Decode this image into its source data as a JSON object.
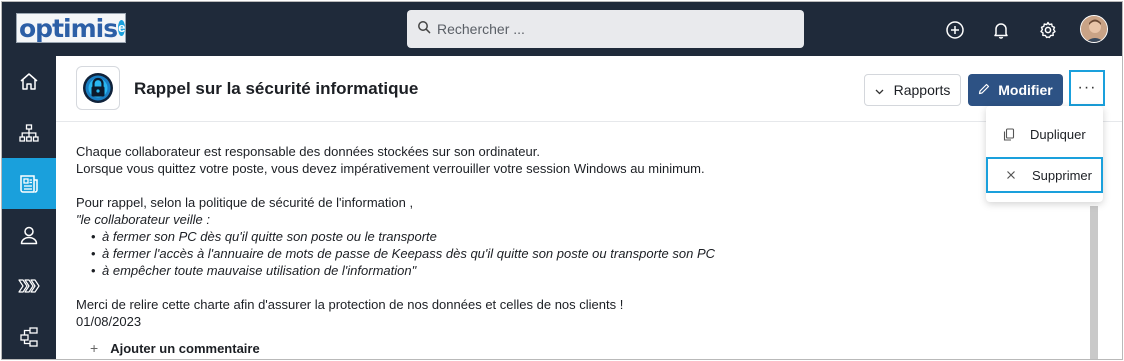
{
  "brand": {
    "logo_text": "optimis",
    "logo_badge": "e"
  },
  "search": {
    "placeholder": "Rechercher ..."
  },
  "topbar": {
    "icons": [
      "plus-circle-icon",
      "bell-icon",
      "gear-icon"
    ],
    "avatar": "user-avatar"
  },
  "sidebar": {
    "items": [
      {
        "name": "home-icon",
        "active": false
      },
      {
        "name": "org-chart-icon",
        "active": false
      },
      {
        "name": "news-icon",
        "active": true
      },
      {
        "name": "person-icon",
        "active": false
      },
      {
        "name": "chevrons-icon",
        "active": false
      },
      {
        "name": "process-icon",
        "active": false
      }
    ]
  },
  "header": {
    "title": "Rappel sur la sécurité informatique",
    "rapports_label": "Rapports",
    "modifier_label": "Modifier",
    "more_label": "···"
  },
  "menu": {
    "items": [
      {
        "label": "Dupliquer",
        "icon": "copy-icon"
      },
      {
        "label": "Supprimer",
        "icon": "close-icon"
      }
    ]
  },
  "content": {
    "line1": "Chaque collaborateur est responsable des données stockées sur son ordinateur.",
    "line2": "Lorsque vous quittez votre poste, vous devez impérativement verrouiller votre session Windows au minimum.",
    "line3": "Pour rappel, selon la politique de sécurité de l'information ,",
    "quote": "\"le collaborateur veille :",
    "bullets": [
      "à fermer son PC dès qu'il quitte son poste ou le transporte",
      "à fermer l'accès à l'annuaire de mots de passe de Keepass dès qu'il quitte son poste ou transporte son PC",
      "à empêcher toute mauvaise utilisation de l'information\""
    ],
    "line4": "Merci de relire cette charte afin d'assurer la protection de nos données et celles de nos clients !",
    "date": "01/08/2023",
    "add_comment": "Ajouter un commentaire"
  },
  "colors": {
    "topbar": "#1f2a3a",
    "accent": "#1aa0dc",
    "primary_button": "#2d5284"
  }
}
